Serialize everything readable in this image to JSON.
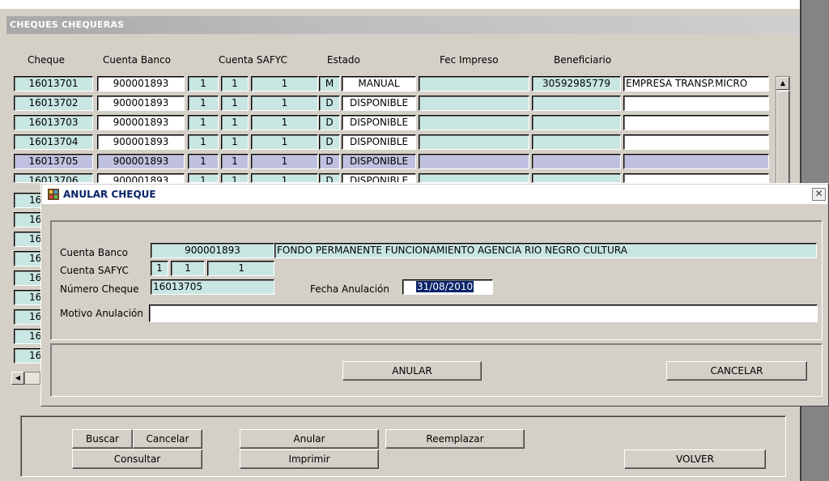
{
  "main": {
    "title": "CHEQUES CHEQUERAS",
    "columns": [
      "Cheque",
      "Cuenta Banco",
      "Cuenta SAFYC",
      "Estado",
      "Fec Impreso",
      "Beneficiario"
    ],
    "rows": [
      {
        "cheque": "16013701",
        "cuenta": "900001893",
        "s1": "1",
        "s2": "1",
        "s3": "1",
        "cod": "M",
        "estado": "MANUAL",
        "fec": "",
        "benef_id": "30592985779",
        "benef": "EMPRESA TRANSP.MICRO"
      },
      {
        "cheque": "16013702",
        "cuenta": "900001893",
        "s1": "1",
        "s2": "1",
        "s3": "1",
        "cod": "D",
        "estado": "DISPONIBLE",
        "fec": "",
        "benef_id": "",
        "benef": ""
      },
      {
        "cheque": "16013703",
        "cuenta": "900001893",
        "s1": "1",
        "s2": "1",
        "s3": "1",
        "cod": "D",
        "estado": "DISPONIBLE",
        "fec": "",
        "benef_id": "",
        "benef": ""
      },
      {
        "cheque": "16013704",
        "cuenta": "900001893",
        "s1": "1",
        "s2": "1",
        "s3": "1",
        "cod": "D",
        "estado": "DISPONIBLE",
        "fec": "",
        "benef_id": "",
        "benef": ""
      },
      {
        "cheque": "16013705",
        "cuenta": "900001893",
        "s1": "1",
        "s2": "1",
        "s3": "1",
        "cod": "D",
        "estado": "DISPONIBLE",
        "fec": "",
        "benef_id": "",
        "benef": ""
      },
      {
        "cheque": "16013706",
        "cuenta": "900001893",
        "s1": "1",
        "s2": "1",
        "s3": "1",
        "cod": "D",
        "estado": "DISPONIBLE",
        "fec": "",
        "benef_id": "",
        "benef": ""
      }
    ],
    "hidden_row_prefix": "16"
  },
  "buttons": {
    "buscar": "Buscar",
    "cancelar": "Cancelar",
    "anular": "Anular",
    "reemplazar": "Reemplazar",
    "consultar": "Consultar",
    "imprimir": "Imprimir",
    "volver": "VOLVER"
  },
  "dialog": {
    "title": "ANULAR CHEQUE",
    "close": "✕",
    "cuenta_banco_label": "Cuenta Banco",
    "cuenta_banco": "900001893",
    "cuenta_banco_desc": "FONDO PERMANENTE FUNCIONAMIENTO AGENCIA RIO NEGRO CULTURA",
    "cuenta_safyc_label": "Cuenta SAFYC",
    "safyc1": "1",
    "safyc2": "1",
    "safyc3": "1",
    "numero_label": "Número Cheque",
    "numero": "16013705",
    "fecha_label": "Fecha Anulación",
    "fecha": "31/08/2010",
    "motivo_label": "Motivo Anulación",
    "motivo": "",
    "btn_anular": "ANULAR",
    "btn_cancelar": "CANCELAR"
  },
  "colors": {
    "teal_field": "#c8e6e2",
    "selected_row": "#c0c0e0",
    "window_bg": "#d4d0c8"
  }
}
